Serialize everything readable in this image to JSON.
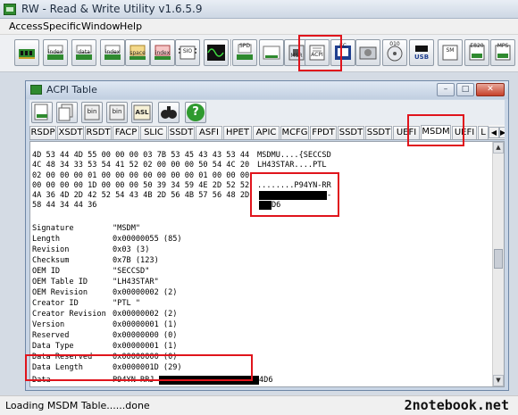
{
  "app": {
    "title": "RW - Read & Write Utility v1.6.5.9"
  },
  "menu": [
    "Access",
    "Specific",
    "Window",
    "Help"
  ],
  "toolbar": {
    "buttons": [
      {
        "icon": "memory-icon",
        "label": ""
      },
      {
        "icon": "pci-index-icon",
        "label": "index"
      },
      {
        "icon": "pci-data-icon",
        "label": "data"
      },
      {
        "icon": "io-index-icon",
        "label": "index"
      },
      {
        "icon": "io-space-icon",
        "label": "space"
      },
      {
        "icon": "index-data-icon",
        "label": "index"
      },
      {
        "icon": "sio-icon",
        "label": "SIO"
      },
      {
        "icon": "waveform-icon",
        "label": ""
      },
      {
        "icon": "spd-smbus-icon",
        "label": "SPD"
      },
      {
        "icon": "msr-icon",
        "label": "MSR"
      },
      {
        "icon": "acpi-icon",
        "label": "ACPI"
      },
      {
        "icon": "ec-icon",
        "label": "EC"
      },
      {
        "icon": "hdd-icon",
        "label": ""
      },
      {
        "icon": "atapi-icon",
        "label": "010"
      },
      {
        "icon": "usb-icon",
        "label": "USB"
      },
      {
        "icon": "smbios-icon",
        "label": "SM"
      },
      {
        "icon": "e820-icon",
        "label": "E820"
      },
      {
        "icon": "mps-icon",
        "label": "MPS"
      }
    ]
  },
  "inner_window": {
    "title": "ACPI Table",
    "toolbar": [
      {
        "icon": "rsdp-icon",
        "label": ""
      },
      {
        "icon": "copy-icon",
        "label": ""
      },
      {
        "icon": "save-bin-icon",
        "label": "bin"
      },
      {
        "icon": "save-all-bin-icon",
        "label": "bin"
      },
      {
        "icon": "asl-icon",
        "label": "ASL"
      },
      {
        "icon": "binoculars-icon",
        "label": ""
      },
      {
        "icon": "help-icon",
        "label": "?"
      }
    ],
    "tabs": [
      "RSDP",
      "XSDT",
      "RSDT",
      "FACP",
      "SLIC",
      "SSDT",
      "ASFI",
      "HPET",
      "APIC",
      "MCFG",
      "FPDT",
      "SSDT",
      "SSDT",
      "UEFI",
      "MSDM",
      "UEFI",
      "L"
    ],
    "active_tab": "MSDM",
    "hex_lines": [
      {
        "hex": "4D 53 44 4D 55 00 00 00 03 7B 53 45 43 43 53 44",
        "ascii": "MSDMU....{SECCSD"
      },
      {
        "hex": "4C 48 34 33 53 54 41 52 02 00 00 00 50 54 4C 20",
        "ascii": "LH43STAR....PTL"
      },
      {
        "hex": "02 00 00 00 01 00 00 00 00 00 00 00 01 00 00 00",
        "ascii": ""
      },
      {
        "hex": "00 00 00 00 1D 00 00 00 50 39 34 59 4E 2D 52 52",
        "ascii": "........P94YN-RR"
      },
      {
        "hex": "4A 36 4D 2D 42 52 54 43 4B 2D 56 4B 57 56 48 2D",
        "ascii": "-"
      },
      {
        "hex": "58 44 34 44 36",
        "ascii": "D6"
      }
    ],
    "fields": [
      {
        "name": "Signature",
        "value": "\"MSDM\""
      },
      {
        "name": "Length",
        "value": "0x00000055 (85)"
      },
      {
        "name": "Revision",
        "value": "0x03 (3)"
      },
      {
        "name": "Checksum",
        "value": "0x7B (123)"
      },
      {
        "name": "OEM ID",
        "value": "\"SECCSD\""
      },
      {
        "name": "OEM Table ID",
        "value": "\"LH43STAR\""
      },
      {
        "name": "OEM Revision",
        "value": "0x00000002 (2)"
      },
      {
        "name": "Creator ID",
        "value": "\"PTL \""
      },
      {
        "name": "Creator Revision",
        "value": "0x00000002 (2)"
      },
      {
        "name": "Version",
        "value": "0x00000001 (1)"
      },
      {
        "name": "Reserved",
        "value": "0x00000000 (0)"
      },
      {
        "name": "Data Type",
        "value": "0x00000001 (1)"
      },
      {
        "name": "Data Reserved",
        "value": "0x00000000 (0)"
      },
      {
        "name": "Data Length",
        "value": "0x0000001D (29)"
      }
    ],
    "data_field": {
      "name": "Data",
      "value_prefix": "P94YN-RRJ",
      "value_suffix": "4D6"
    }
  },
  "status": {
    "text": "Loading MSDM Table......done"
  },
  "watermark": "2notebook.net",
  "colors": {
    "highlight_box": "#e0141c",
    "redaction": "#000000"
  }
}
